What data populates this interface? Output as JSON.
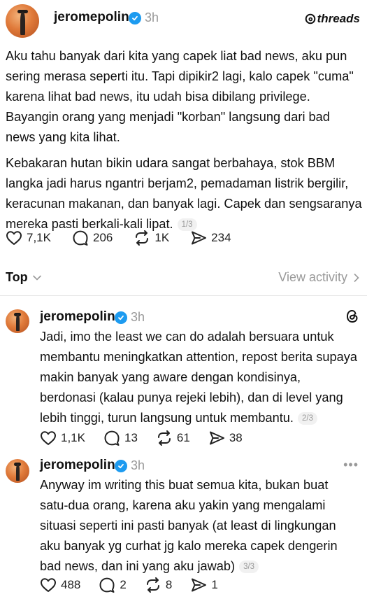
{
  "main_post": {
    "username": "jeromepolin",
    "time": "3h",
    "brand": "threads",
    "paragraphs": [
      "Aku tahu banyak dari kita yang capek liat bad news, aku pun sering merasa seperti itu. Tapi dipikir2 lagi, kalo capek \"cuma\" karena lihat bad news, itu udah bisa dibilang privilege. Bayangin orang yang menjadi \"korban\" langsung dari bad news yang kita lihat.",
      "Kebakaran hutan bikin udara sangat berbahaya, stok BBM langka jadi harus ngantri berjam2, pemadaman listrik bergilir, keracunan makanan, dan banyak lagi. Capek dan sengsaranya mereka pasti berkali-kali lipat."
    ],
    "counter": "1/3",
    "likes": "7,1K",
    "replies": "206",
    "reposts": "1K",
    "shares": "234"
  },
  "filter": {
    "sort_label": "Top",
    "view_activity": "View activity"
  },
  "replies": [
    {
      "username": "jeromepolin",
      "time": "3h",
      "text": "Jadi, imo the least we can do adalah bersuara untuk membantu meningkatkan attention, repost berita supaya makin banyak yang aware dengan kondisinya, berdonasi (kalau punya rejeki lebih), dan di level yang lebih tinggi, turun langsung untuk membantu.",
      "counter": "2/3",
      "likes": "1,1K",
      "replies": "13",
      "reposts": "61",
      "shares": "38"
    },
    {
      "username": "jeromepolin",
      "time": "3h",
      "text": "Anyway im writing this buat semua kita, bukan buat satu-dua orang, karena aku yakin yang mengalami situasi seperti ini pasti banyak (at least di lingkungan aku banyak yg curhat jg kalo mereka capek dengerin bad news, dan ini yang aku jawab)",
      "counter": "3/3",
      "likes": "488",
      "replies": "2",
      "reposts": "8",
      "shares": "1"
    }
  ],
  "colors": {
    "verified": "#1d9bf0",
    "muted": "#999999"
  }
}
